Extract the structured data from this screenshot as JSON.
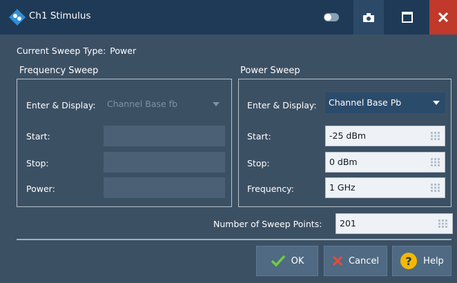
{
  "window": {
    "title": "Ch1 Stimulus",
    "close_glyph": "✕",
    "close_color": "#c0392b"
  },
  "current_sweep": {
    "label": "Current Sweep Type:",
    "value": "Power"
  },
  "frequency_sweep": {
    "title": "Frequency Sweep",
    "enter_display_label": "Enter & Display:",
    "enter_display_value": "Channel Base fb",
    "start_label": "Start:",
    "stop_label": "Stop:",
    "power_label": "Power:",
    "enabled": false
  },
  "power_sweep": {
    "title": "Power Sweep",
    "enter_display_label": "Enter & Display:",
    "enter_display_value": "Channel Base Pb",
    "start_label": "Start:",
    "start_value": "-25 dBm",
    "stop_label": "Stop:",
    "stop_value": "0 dBm",
    "frequency_label": "Frequency:",
    "frequency_value": "1 GHz",
    "enabled": true
  },
  "sweep_points": {
    "label": "Number of Sweep Points:",
    "value": "201"
  },
  "buttons": {
    "ok": "OK",
    "cancel": "Cancel",
    "help": "Help"
  },
  "icons": {
    "app": "rohde-schwarz-logo-icon",
    "toggle": "toggle-icon",
    "camera": "camera-icon",
    "maximize": "maximize-icon",
    "close": "close-icon",
    "numpad": "numpad-icon",
    "ok": "checkmark-icon",
    "cancel": "cross-icon",
    "help": "help-icon"
  },
  "colors": {
    "background": "#3c5064",
    "titlebar": "#1e3a56",
    "ok_check": "#6fcf3b",
    "cancel_cross": "#e74c3c",
    "help_badge": "#f5b800"
  }
}
